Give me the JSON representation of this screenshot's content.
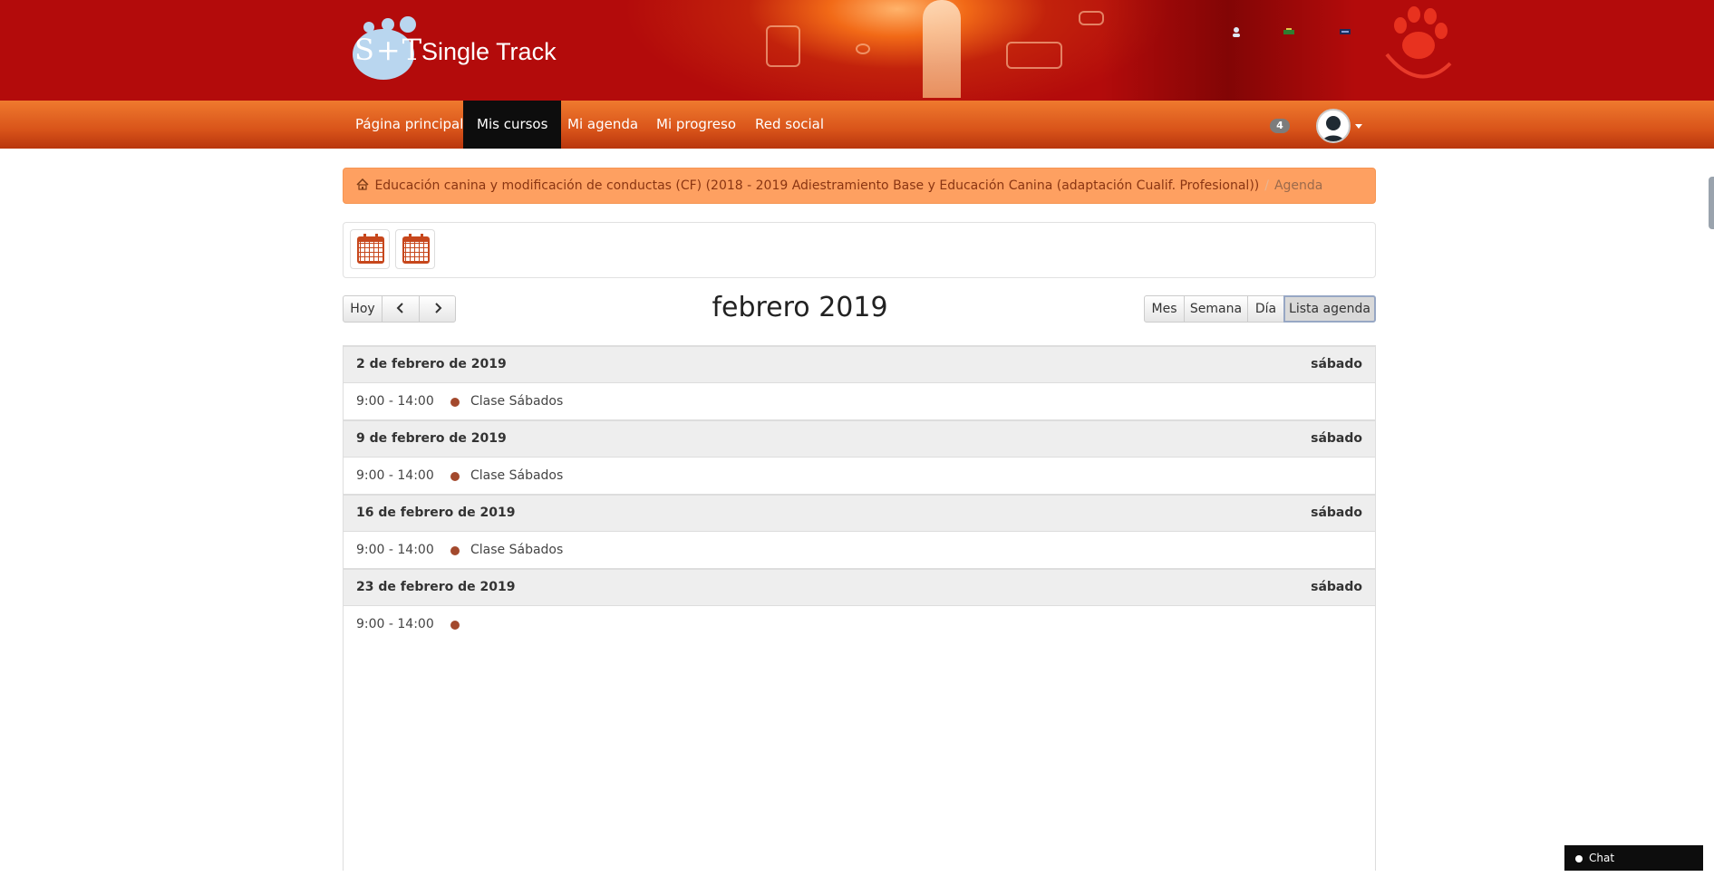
{
  "header": {
    "logo_mark": "S+T",
    "logo_text": "Single Track"
  },
  "navbar": {
    "items": [
      {
        "label": "Página principal"
      },
      {
        "label": "Mis cursos",
        "active": true
      },
      {
        "label": "Mi agenda"
      },
      {
        "label": "Mi progreso"
      },
      {
        "label": "Red social"
      }
    ],
    "notification_count": "4"
  },
  "breadcrumb": {
    "course": "Educación canina y modificación de conductas (CF) (2018 - 2019 Adiestramiento Base y Educación Canina (adaptación Cualif. Profesional))",
    "separator": "/",
    "current": "Agenda"
  },
  "toolbar_icons": [
    "calendar-icon",
    "calendar-icon"
  ],
  "calendar": {
    "nav": {
      "today": "Hoy",
      "prev": "‹",
      "next": "›"
    },
    "title": "febrero 2019",
    "views": [
      {
        "label": "Mes"
      },
      {
        "label": "Semana"
      },
      {
        "label": "Día"
      },
      {
        "label": "Lista agenda",
        "active": true
      }
    ],
    "days": [
      {
        "date": "2 de febrero de 2019",
        "weekday": "sábado",
        "events": [
          {
            "time": "9:00 - 14:00",
            "title": "Clase Sábados"
          }
        ]
      },
      {
        "date": "9 de febrero de 2019",
        "weekday": "sábado",
        "events": [
          {
            "time": "9:00 - 14:00",
            "title": "Clase Sábados"
          }
        ]
      },
      {
        "date": "16 de febrero de 2019",
        "weekday": "sábado",
        "events": [
          {
            "time": "9:00 - 14:00",
            "title": "Clase Sábados"
          }
        ]
      },
      {
        "date": "23 de febrero de 2019",
        "weekday": "sábado",
        "events": [
          {
            "time": "9:00 - 14:00",
            "title": ""
          }
        ]
      }
    ],
    "event_color": "#a3492d"
  },
  "chat": {
    "label": "Chat (Desconectado)"
  },
  "colors": {
    "banner": "#b30b0b",
    "navbar": "#d9541a",
    "breadcrumb": "#fea061",
    "active_nav": "#0d0d0d"
  }
}
